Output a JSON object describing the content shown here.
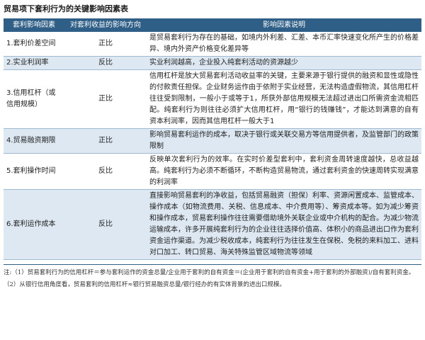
{
  "title": "贸易项下套利行为的关键影响因素表",
  "table": {
    "headers": [
      "套利影响因素",
      "对套利收益的影响方向",
      "影响因素说明"
    ],
    "rows": [
      {
        "factor": "1.套利价差空间",
        "direction": "正比",
        "desc": "是贸易套利行为存在的基础，如境内外利差、汇差、本币汇率快速变化所产生的价格差异、境内外资产价格变化差异等"
      },
      {
        "factor": "2.实业利润率",
        "direction": "反比",
        "desc": "实业利润越高，企业投入纯套利活动的资源越少"
      },
      {
        "factor": "3.信用杠杆（或信用规模）",
        "direction": "正比",
        "desc": "信用杠杆是放大贸易套利活动收益率的关键，主要来源于银行提供的融资和显性或隐性的付款责任担保。企业财务运作由于依附于实业经营，无法构造虚假物流，其信用杠杆往往受到限制，一般小于或等于1，所获外部信用规模无法超过进出口所需资金流相匹配。纯套利行为则往往必须扩大信用杠杆，用“银行的钱赚钱”，才能达到满意的自有资本利润率，因而其信用杠杆一般大于1"
      },
      {
        "factor": "4.贸易融资期限",
        "direction": "正比",
        "desc": "影响贸易套利运作的成本，取决于银行或关联交易方等信用提供者，及监管部门的政策限制"
      },
      {
        "factor": "5.套利操作时间",
        "direction": "反比",
        "desc": "反映单次套利行为的效率。在实时价差型套利中，套利资金周转速度越快，总收益越高。纯套利行为必须不断循环，不断构造贸易物流，通过套利资金的快速周转实现满意的利润率"
      },
      {
        "factor": "6.套利运作成本",
        "direction": "反比",
        "desc": "直接影响贸易套利的净收益，包括贸易融资（担保）利率、资源闲置成本、监管成本、操作成本（如物流费用、关税、信息成本、中介费用等）、筹资成本等。如为减少筹资和操作成本，贸易套利操作往往需要借助境外关联企业或中介机构的配合。为减少物流运输成本，许多开展纯套利行为的企业往往选择价值高、体积小的商品进出口作为套利资金运作渠道。为减少税收成本，纯套利行为往往发生在保税、免税的来料加工、进料对口加工、转口贸易、海关特殊监管区域物流等领域"
      }
    ]
  },
  "notes": [
    "注:（1）贸易套利行为的信用杠杆＝参与套利运作的资金总量/企业用于套利的自有资金＝(企业用于套利的自有资金+用于套利的外部融资)/自有套利资金。",
    "（2）从银行信用角度看，贸易套利的信用杠杆≈银行贸易融资总量/银行经办的有实体背景的进出口规模。"
  ],
  "colors": {
    "header_bg": "#2f5f87",
    "row_shaded": "#dde8f2",
    "row_border": "#9dbad2"
  }
}
